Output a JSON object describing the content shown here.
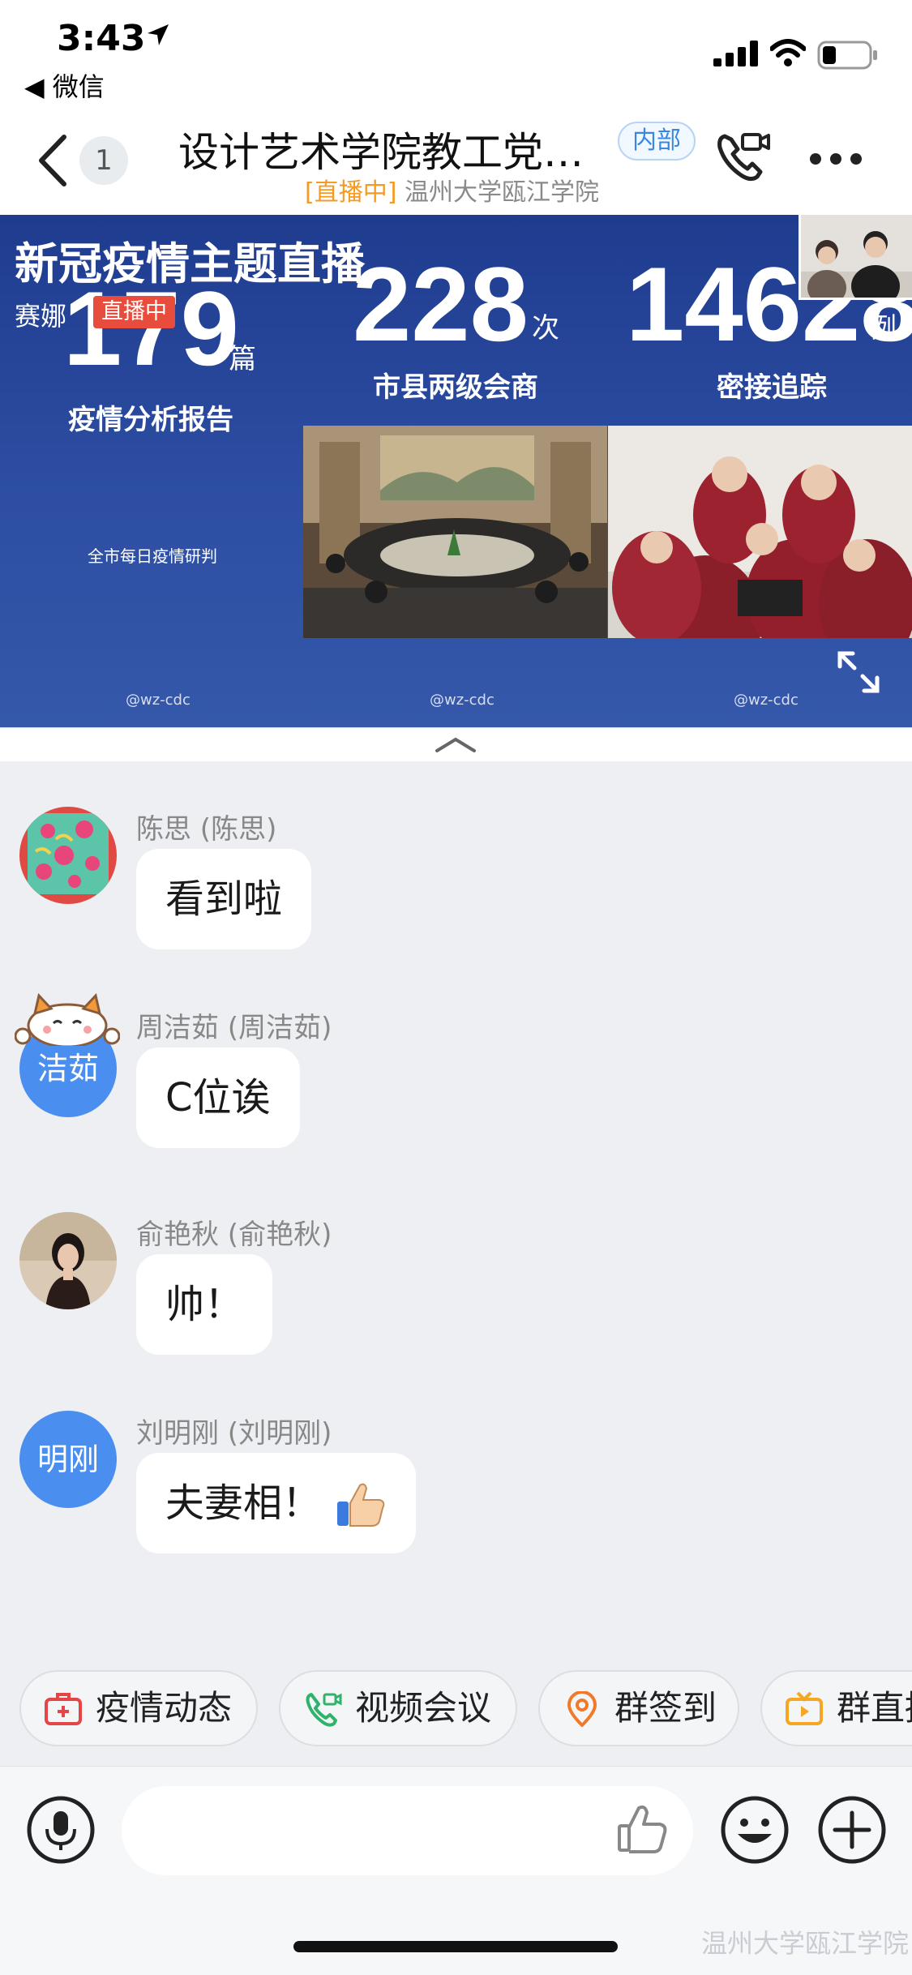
{
  "status_bar": {
    "time": "3:43",
    "back_app": "◀ 微信"
  },
  "nav": {
    "badge_count": "1",
    "title": "设计艺术学院教工党…",
    "tag": "内部",
    "subtitle_live": "[直播中]",
    "subtitle_org": "温州大学瓯江学院"
  },
  "live": {
    "title": "新冠疫情主题直播",
    "host": "赛娜",
    "live_badge": "直播中",
    "stats": [
      {
        "number": "179",
        "unit": "篇",
        "label": "疫情分析报告",
        "note": "全市每日疫情研判"
      },
      {
        "number": "228",
        "unit": "次",
        "label": "市县两级会商"
      },
      {
        "number": "14628",
        "unit": "例",
        "label": "密接追踪"
      }
    ],
    "watermark": "@wz-cdc"
  },
  "messages": [
    {
      "sender": "陈思 (陈思)",
      "text": "看到啦",
      "avatar_type": "image"
    },
    {
      "sender": "周洁茹 (周洁茹)",
      "text": "C位诶",
      "avatar_text": "洁茹"
    },
    {
      "sender": "俞艳秋 (俞艳秋)",
      "text": "帅！",
      "avatar_type": "image"
    },
    {
      "sender": "刘明刚 (刘明刚)",
      "text": "夫妻相！",
      "avatar_text": "明刚",
      "emoji": "👍"
    }
  ],
  "chips": [
    {
      "label": "疫情动态",
      "icon": "medical-kit-icon",
      "color": "#e64545"
    },
    {
      "label": "视频会议",
      "icon": "video-call-icon",
      "color": "#2fb36b"
    },
    {
      "label": "群签到",
      "icon": "location-pin-icon",
      "color": "#f07a2a"
    },
    {
      "label": "群直播",
      "icon": "tv-icon",
      "color": "#f5a623"
    }
  ],
  "input": {
    "placeholder": ""
  },
  "corner_watermark": "温州大学瓯江学院"
}
